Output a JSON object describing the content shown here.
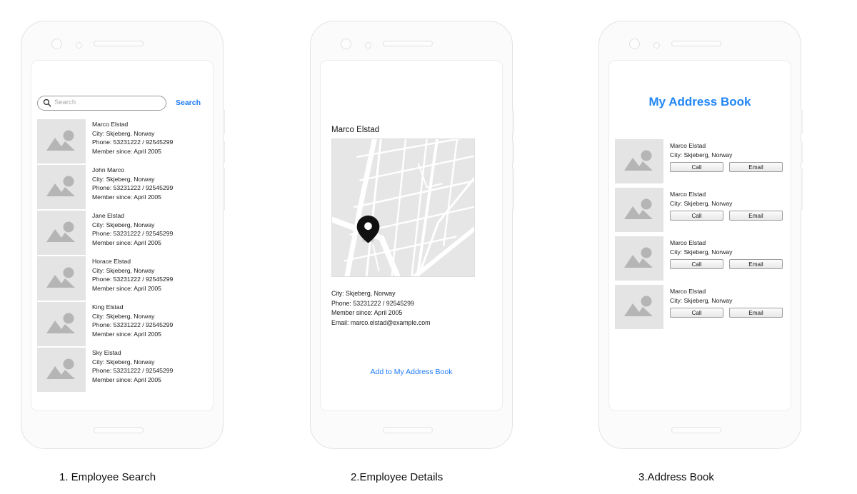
{
  "accent_blue": "#1f7bf7",
  "title_blue": "#2186f5",
  "screen1": {
    "search": {
      "placeholder": "Search",
      "value": "",
      "icon": "search-icon",
      "button_label": "Search"
    },
    "employees": [
      {
        "name": "Marco Elstad",
        "city": "City: Skjeberg, Norway",
        "phone": "Phone: 53231222 / 92545299",
        "member": "Member since: April 2005"
      },
      {
        "name": "John Marco",
        "city": "City: Skjeberg, Norway",
        "phone": "Phone: 53231222 / 92545299",
        "member": "Member since: April 2005"
      },
      {
        "name": "Jane Elstad",
        "city": "City: Skjeberg, Norway",
        "phone": "Phone: 53231222 / 92545299",
        "member": "Member since: April 2005"
      },
      {
        "name": "Horace Elstad",
        "city": "City: Skjeberg, Norway",
        "phone": "Phone: 53231222 / 92545299",
        "member": "Member since: April 2005"
      },
      {
        "name": "King Elstad",
        "city": "City: Skjeberg, Norway",
        "phone": "Phone: 53231222 / 92545299",
        "member": "Member since: April 2005"
      },
      {
        "name": "Sky Elstad",
        "city": "City: Skjeberg, Norway",
        "phone": "Phone: 53231222 / 92545299",
        "member": "Member since: April 2005"
      }
    ]
  },
  "screen2": {
    "name": "Marco Elstad",
    "map": {
      "pin": "map-pin-icon"
    },
    "details": [
      "City: Skjeberg, Norway",
      "Phone: 53231222 / 92545299",
      "Member since: April 2005",
      "Email: marco.elstad@example.com"
    ],
    "add_link": "Add to My Address Book"
  },
  "screen3": {
    "title": "My Address Book",
    "contacts": [
      {
        "name": "Marco Elstad",
        "city": "City: Skjeberg, Norway",
        "call_label": "Call",
        "email_label": "Email"
      },
      {
        "name": "Marco Elstad",
        "city": "City: Skjeberg, Norway",
        "call_label": "Call",
        "email_label": "Email"
      },
      {
        "name": "Marco Elstad",
        "city": "City: Skjeberg, Norway",
        "call_label": "Call",
        "email_label": "Email"
      },
      {
        "name": "Marco Elstad",
        "city": "City: Skjeberg, Norway",
        "call_label": "Call",
        "email_label": "Email"
      }
    ]
  },
  "captions": {
    "one": "1. Employee Search",
    "two": "2.Employee Details",
    "three": "3.Address Book"
  }
}
